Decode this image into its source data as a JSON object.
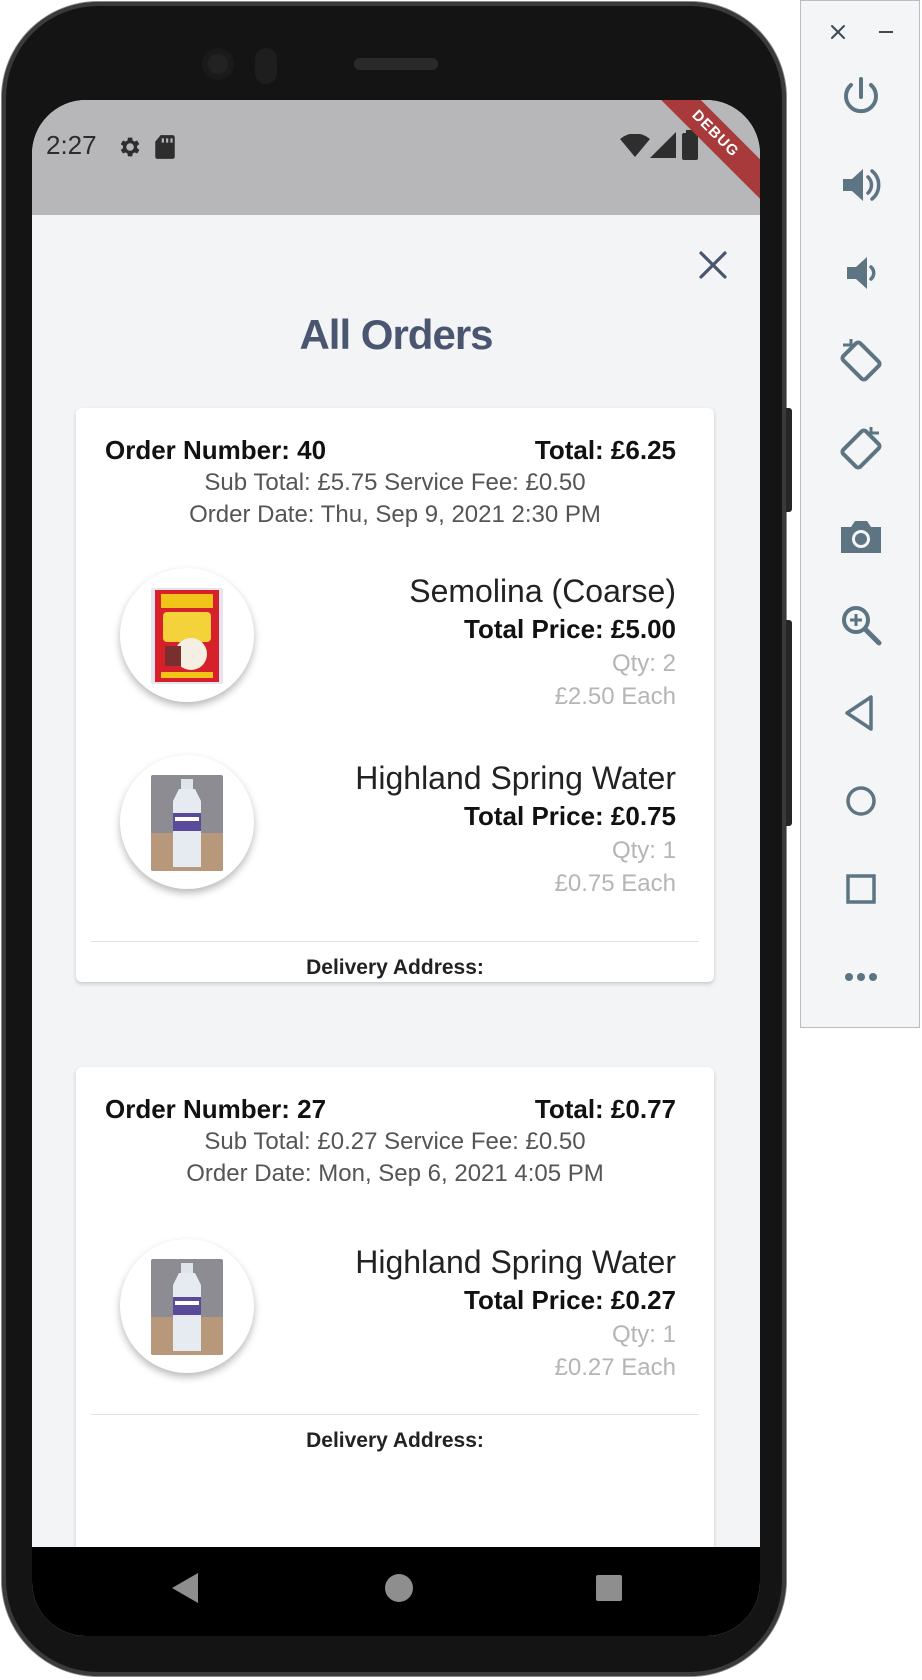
{
  "status_bar": {
    "time": "2:27",
    "icons": [
      "settings-icon",
      "sd-card-icon",
      "wifi-icon",
      "signal-icon",
      "battery-icon"
    ],
    "debug_banner": "DEBUG",
    "background": "#b7b7b9"
  },
  "page": {
    "title": "All Orders",
    "close_icon": "close-icon"
  },
  "orders": [
    {
      "order_number": "Order Number: 40",
      "total": "Total: £6.25",
      "subtotal_fee": "Sub Total: £5.75 Service Fee: £0.50",
      "order_date": "Order Date: Thu, Sep 9, 2021 2:30 PM",
      "items": [
        {
          "name": "Semolina (Coarse)",
          "total_price": "Total Price: £5.00",
          "qty": "Qty: 2",
          "each": "£2.50 Each"
        },
        {
          "name": "Highland Spring Water",
          "total_price": "Total Price: £0.75",
          "qty": "Qty: 1",
          "each": "£0.75 Each"
        }
      ],
      "delivery_label": "Delivery Address:"
    },
    {
      "order_number": "Order Number: 27",
      "total": "Total: £0.77",
      "subtotal_fee": "Sub Total: £0.27 Service Fee: £0.50",
      "order_date": "Order Date: Mon, Sep 6, 2021 4:05 PM",
      "items": [
        {
          "name": "Highland Spring Water",
          "total_price": "Total Price: £0.27",
          "qty": "Qty: 1",
          "each": "£0.27 Each"
        }
      ],
      "delivery_label": "Delivery Address:"
    }
  ],
  "nav_bar": {
    "buttons": [
      "back-icon",
      "home-icon",
      "recents-icon"
    ]
  },
  "emulator_toolbar": {
    "window_buttons": [
      "close-icon",
      "minimize-icon"
    ],
    "buttons": [
      "power-icon",
      "volume-up-icon",
      "volume-down-icon",
      "rotate-left-icon",
      "rotate-right-icon",
      "camera-icon",
      "zoom-icon",
      "back-icon",
      "home-icon",
      "overview-icon",
      "more-icon"
    ]
  },
  "colors": {
    "title": "#4a5670",
    "muted": "#b5b5b5",
    "card_bg": "#ffffff",
    "page_bg": "#f3f4f6",
    "toolbar_icon": "#5d7582",
    "debug_ribbon": "#a83a3c"
  }
}
